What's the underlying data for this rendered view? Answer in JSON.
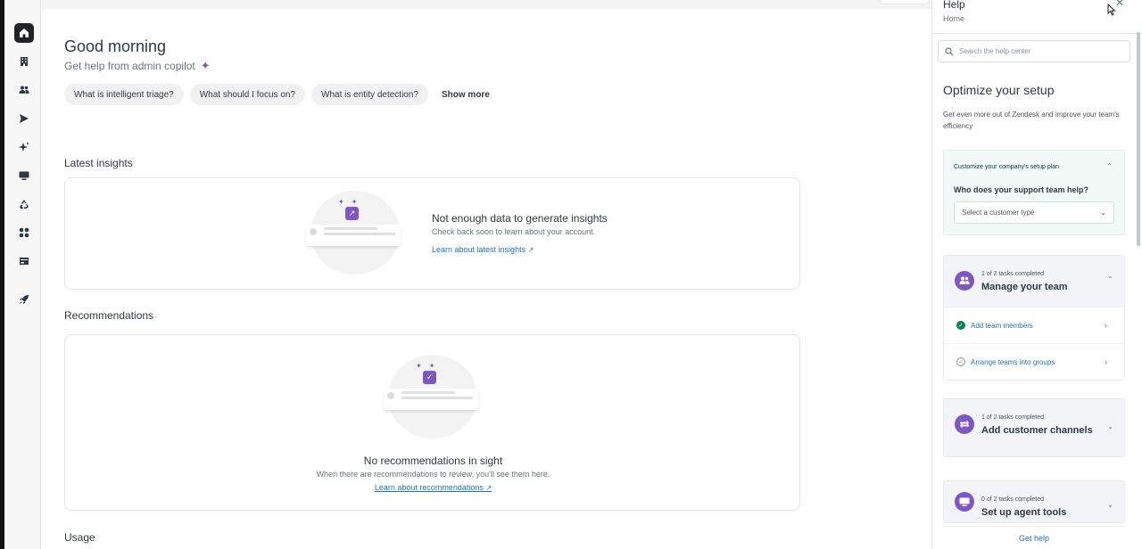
{
  "nav": {
    "items": [
      {
        "name": "nav-home",
        "icon": "home-icon",
        "active": true
      },
      {
        "name": "nav-organization",
        "icon": "building-icon"
      },
      {
        "name": "nav-people",
        "icon": "people-icon"
      },
      {
        "name": "nav-channels",
        "icon": "send-icon"
      },
      {
        "name": "nav-ai",
        "icon": "sparkle-icon"
      },
      {
        "name": "nav-workspaces",
        "icon": "monitor-icon"
      },
      {
        "name": "nav-objects-rules",
        "icon": "recycle-icon"
      },
      {
        "name": "nav-apps-integrations",
        "icon": "apps-grid-icon"
      },
      {
        "name": "nav-account",
        "icon": "card-icon"
      },
      {
        "name": "nav-launch",
        "icon": "rocket-icon"
      }
    ]
  },
  "home": {
    "greeting": "Good morning",
    "subtitle": "Get help from admin copilot",
    "chips": [
      "What is intelligent triage?",
      "What should I focus on?",
      "What is entity detection?"
    ],
    "show_more": "Show more"
  },
  "insights": {
    "section_title": "Latest insights",
    "heading": "Not enough data to generate insights",
    "sub": "Check back soon to learn about your account.",
    "link": "Learn about latest insights"
  },
  "recommendations": {
    "section_title": "Recommendations",
    "heading": "No recommendations in sight",
    "sub": "When there are recommendations to review, you'll see them here.",
    "link": "Learn about recommendations"
  },
  "usage": {
    "section_title": "Usage"
  },
  "help": {
    "title": "Help",
    "breadcrumb": "Home",
    "search_placeholder": "Search the help center",
    "optimize_title": "Optimize your setup",
    "optimize_desc": "Get even more out of Zendesk and improve your team's efficiency",
    "customize_label": "Customize your company's setup plan",
    "question": "Who does your support team help?",
    "select_value": "Select a customer type",
    "tasks": [
      {
        "meta": "1 of 2 tasks completed",
        "name": "Manage your team",
        "subtasks": [
          {
            "label": "Add team members",
            "done": true
          },
          {
            "label": "Arrange teams into groups",
            "done": false
          }
        ]
      },
      {
        "meta": "1 of 2 tasks completed",
        "name": "Add customer channels"
      },
      {
        "meta": "0 of 2 tasks completed",
        "name": "Set up agent tools"
      }
    ],
    "get_help": "Get help"
  },
  "colors": {
    "accent": "#7e57c2",
    "link": "#1f73b7",
    "success": "#038153"
  }
}
